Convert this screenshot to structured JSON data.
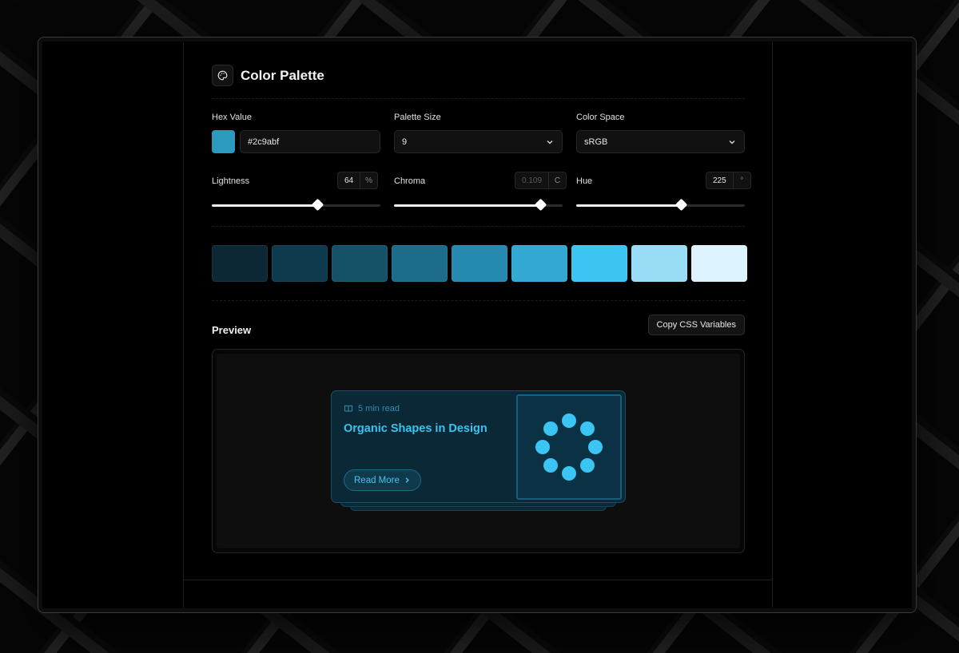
{
  "header": {
    "title": "Color Palette",
    "icon": "palette-icon"
  },
  "controls": {
    "hex": {
      "label": "Hex Value",
      "value": "#2c9abf",
      "swatch_color": "#2c9abf"
    },
    "palette_size": {
      "label": "Palette Size",
      "value": "9"
    },
    "color_space": {
      "label": "Color Space",
      "value": "sRGB"
    },
    "lightness": {
      "label": "Lightness",
      "value": "64",
      "unit": "%",
      "fraction": 0.63
    },
    "chroma": {
      "label": "Chroma",
      "value": "0.109",
      "unit": "C",
      "fraction": 0.87
    },
    "hue": {
      "label": "Hue",
      "value": "225",
      "unit": "°",
      "fraction": 0.625
    }
  },
  "palette": [
    "#0c2835",
    "#0e3a4d",
    "#155267",
    "#1d6c8c",
    "#2689b0",
    "#32a8d2",
    "#3cc5f3",
    "#99dcf6",
    "#ddf3fd"
  ],
  "preview": {
    "title": "Preview",
    "copy_button": "Copy CSS Variables",
    "card": {
      "meta": "5 min read",
      "title": "Organic Shapes in Design",
      "button": "Read More"
    }
  }
}
